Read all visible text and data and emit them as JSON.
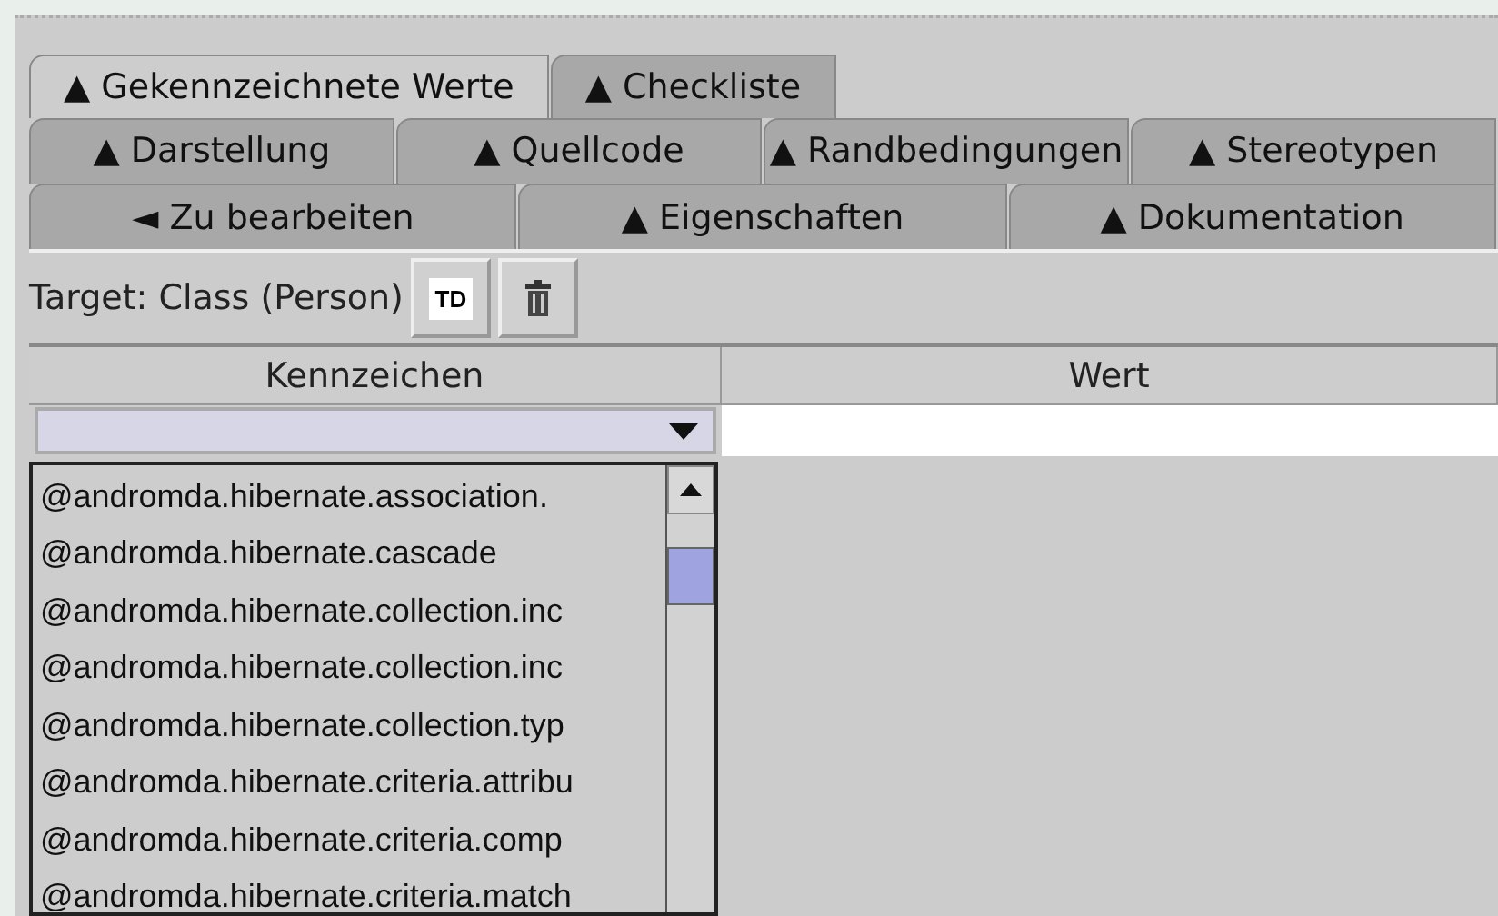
{
  "tab_rows": [
    [
      {
        "label": "▲ Gekennzeichnete Werte",
        "selected": true
      },
      {
        "label": "▲ Checkliste",
        "selected": false
      }
    ],
    [
      {
        "label": "▲ Darstellung",
        "selected": false
      },
      {
        "label": "▲ Quellcode",
        "selected": false
      },
      {
        "label": "▲ Randbedingungen",
        "selected": false
      },
      {
        "label": "▲ Stereotypen",
        "selected": false
      }
    ],
    [
      {
        "label": "◄ Zu bearbeiten",
        "selected": false
      },
      {
        "label": "▲ Eigenschaften",
        "selected": false
      },
      {
        "label": "▲ Dokumentation",
        "selected": false
      }
    ]
  ],
  "target": {
    "label": "Target: Class (Person)",
    "buttons": [
      {
        "kind": "text",
        "label": "TD"
      },
      {
        "kind": "trash"
      }
    ]
  },
  "table": {
    "columns": [
      "Kennzeichen",
      "Wert"
    ]
  },
  "tag_list": [
    "@andromda.hibernate.association.",
    "@andromda.hibernate.cascade",
    "@andromda.hibernate.collection.inc",
    "@andromda.hibernate.collection.inc",
    "@andromda.hibernate.collection.typ",
    "@andromda.hibernate.criteria.attribu",
    "@andromda.hibernate.criteria.comp",
    "@andromda.hibernate.criteria.match"
  ]
}
